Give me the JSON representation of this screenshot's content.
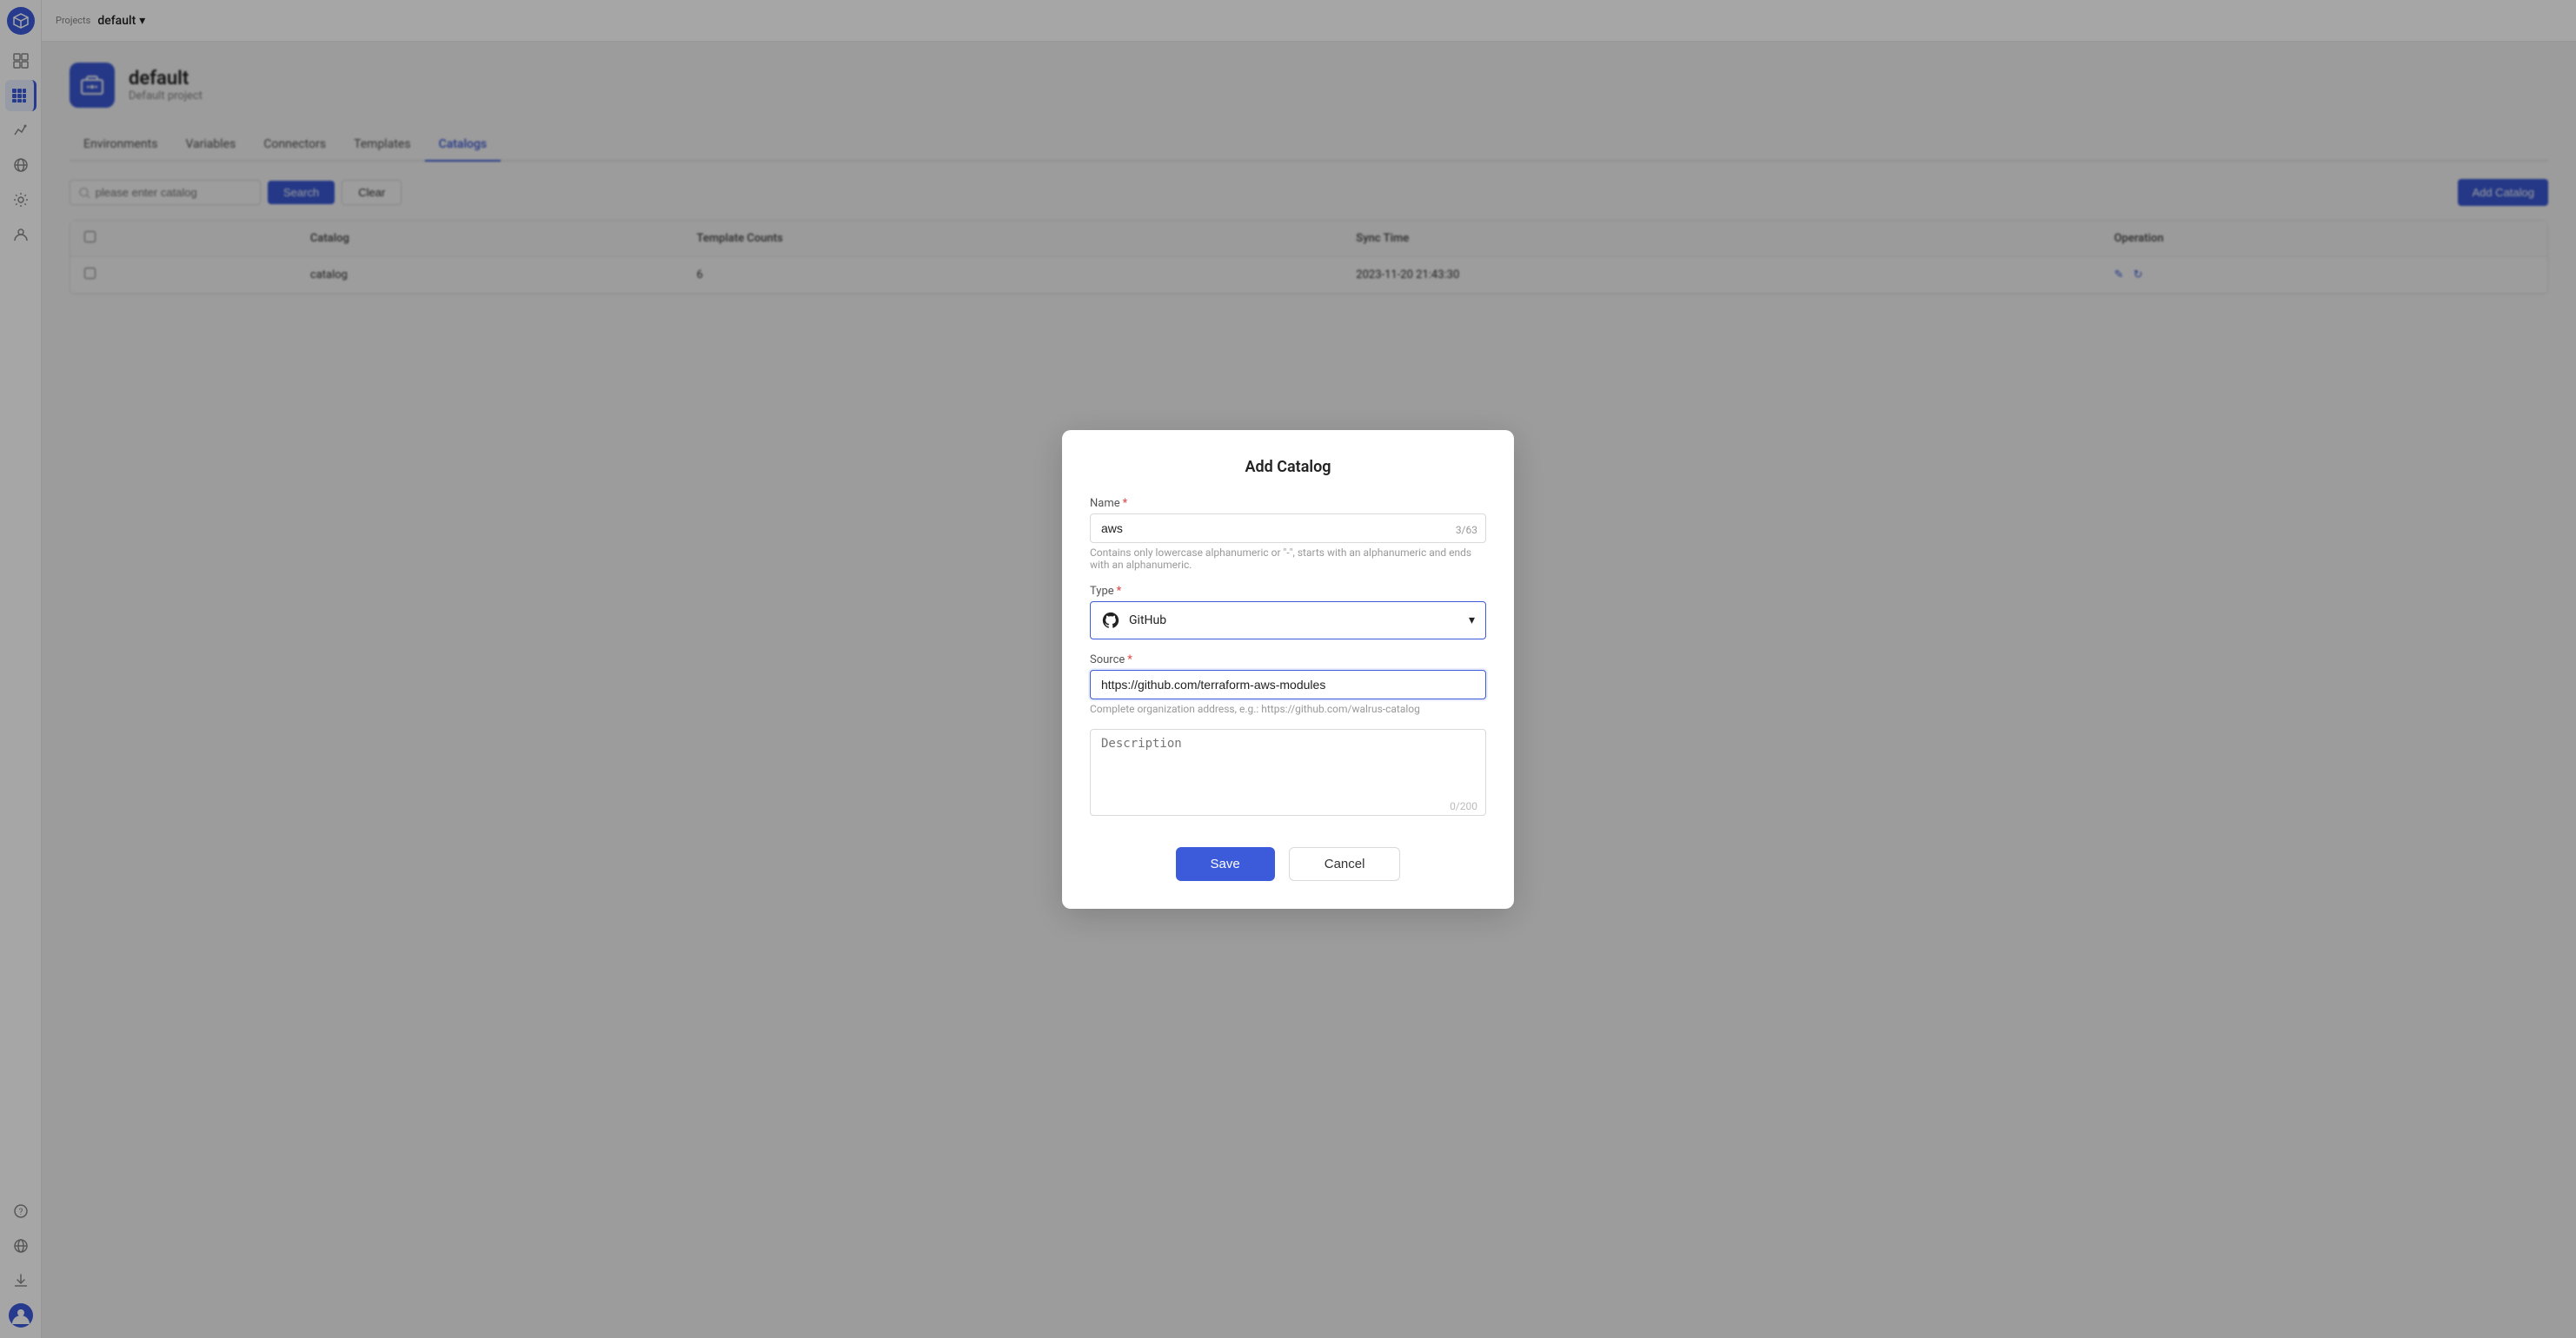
{
  "sidebar": {
    "logo_alt": "Walrus logo",
    "items": [
      {
        "name": "grid-icon",
        "label": "Grid",
        "active": false
      },
      {
        "name": "apps-icon",
        "label": "Apps",
        "active": true
      },
      {
        "name": "chart-icon",
        "label": "Chart",
        "active": false
      },
      {
        "name": "network-icon",
        "label": "Network",
        "active": false
      },
      {
        "name": "settings-icon",
        "label": "Settings",
        "active": false
      },
      {
        "name": "users-icon",
        "label": "Users",
        "active": false
      }
    ],
    "bottom_items": [
      {
        "name": "help-icon",
        "label": "Help"
      },
      {
        "name": "globe-icon",
        "label": "Language"
      },
      {
        "name": "download-icon",
        "label": "Download"
      },
      {
        "name": "user-avatar-icon",
        "label": "User"
      }
    ]
  },
  "topbar": {
    "projects_label": "Projects",
    "project_name": "default",
    "chevron": "▾"
  },
  "project": {
    "name": "default",
    "description": "Default project"
  },
  "tabs": [
    {
      "label": "Environments",
      "active": false
    },
    {
      "label": "Variables",
      "active": false
    },
    {
      "label": "Connectors",
      "active": false
    },
    {
      "label": "Templates",
      "active": false
    },
    {
      "label": "Catalogs",
      "active": true
    }
  ],
  "search": {
    "placeholder": "please enter catalog",
    "search_label": "Search",
    "clear_label": "Clear"
  },
  "table": {
    "columns": [
      "Catalog",
      "Template Counts",
      "Sync Time",
      "Operation"
    ],
    "rows": [
      {
        "catalog": "catalog",
        "template_counts": "6",
        "sync_time": "2023-11-20 21:43:30"
      }
    ]
  },
  "add_catalog_button": "Add Catalog",
  "modal": {
    "title": "Add Catalog",
    "name_label": "Name",
    "name_value": "aws",
    "name_char_count": "3/63",
    "name_hint": "Contains only lowercase alphanumeric or \"-\", starts with an alphanumeric and ends with an alphanumeric.",
    "type_label": "Type",
    "type_value": "GitHub",
    "source_label": "Source",
    "source_value": "https://github.com/terraform-aws-modules",
    "source_hint": "Complete organization address, e.g.: https://github.com/walrus-catalog",
    "description_label": "Description",
    "description_placeholder": "Description",
    "description_char_count": "0/200",
    "save_label": "Save",
    "cancel_label": "Cancel"
  }
}
